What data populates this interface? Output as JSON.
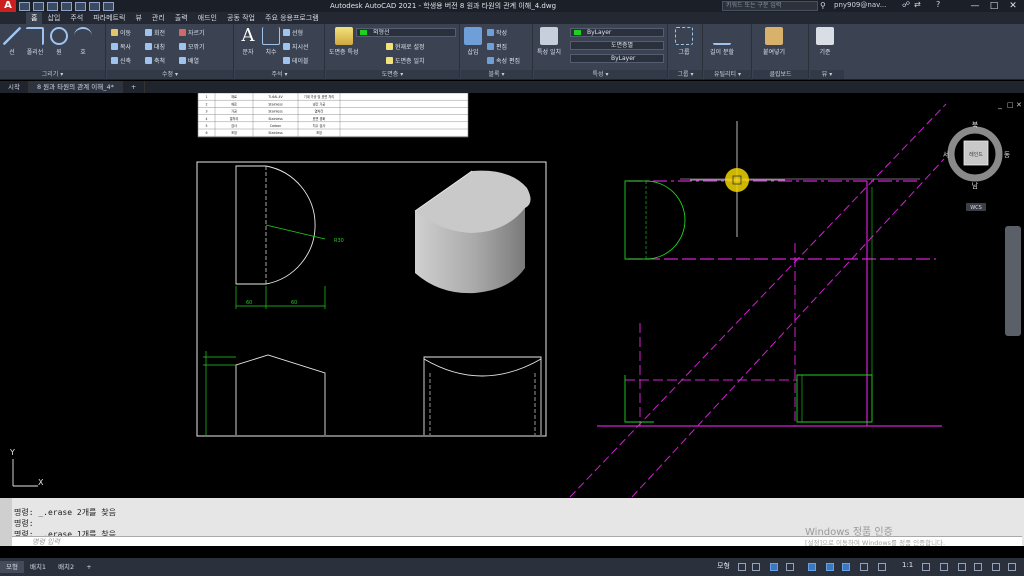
{
  "titlebar": {
    "app_logo": "A",
    "title": "Autodesk AutoCAD 2021 - 학생용 버전    8 원과 타원의 관계 이해_4.dwg",
    "search_placeholder": "키워드 또는 구문 입력",
    "user": "pny909@nav...",
    "minimize": "—",
    "maximize": "□",
    "close": "✕"
  },
  "ribbon_tabs": [
    "홈",
    "삽입",
    "주석",
    "파라메트릭",
    "뷰",
    "관리",
    "출력",
    "애드인",
    "공동 작업",
    "주요 응용프로그램"
  ],
  "ribbon": {
    "draw": {
      "label": "그리기 ▾",
      "line": "선",
      "polyline": "폴리선",
      "circle": "원",
      "arc": "호"
    },
    "modify": {
      "label": "수정 ▾",
      "move": "이동",
      "rotate": "회전",
      "trim": "자르기",
      "copy": "복사",
      "mirror": "대칭",
      "fillet": "모깎기",
      "stretch": "신축",
      "scale": "축척",
      "array": "배열"
    },
    "annotation": {
      "label": "주석 ▾",
      "text": "문자",
      "dimension": "치수",
      "linear": "선형",
      "leader": "지시선",
      "table": "테이블"
    },
    "layers": {
      "label": "도면층 ▾",
      "layer_properties": "도면층 특성",
      "current_layer": "외형선",
      "make_current": "현재로 설정",
      "match": "도면층 일치"
    },
    "block": {
      "label": "블록 ▾",
      "insert": "삽입",
      "create": "작성",
      "edit": "편집",
      "edit_attributes": "속성 편집"
    },
    "properties": {
      "label": "특성 ▾",
      "match_properties": "특성 일치",
      "color": "ByLayer",
      "linetype": "도면층별",
      "lineweight": "ByLayer"
    },
    "groups": {
      "label": "그룹 ▾",
      "group": "그룹"
    },
    "utilities": {
      "label": "유틸리티 ▾",
      "measure": "길이 분할"
    },
    "clipboard": {
      "label": "클립보드",
      "paste": "붙여넣기"
    },
    "view": {
      "label": "뷰 ▾",
      "base": "기준"
    }
  },
  "doc_tabs": [
    "시작",
    "8 원과 타원의 관계 이해_4*"
  ],
  "viewcube": {
    "north": "북",
    "south": "남",
    "east": "동",
    "west": "서",
    "face": "레인드",
    "wcs": "WCS"
  },
  "ucs": {
    "x": "X",
    "y": "Y"
  },
  "table_rows": [
    [
      "1",
      "재료",
      "Ti-6Al-4V",
      "기계 가공 및 표면 처리"
    ],
    [
      "2",
      "재료",
      "Stainless",
      "냉간 가공"
    ],
    [
      "3",
      "가공",
      "Stainless",
      "열처리"
    ],
    [
      "4",
      "열처리",
      "Stainless",
      "표면 경화"
    ],
    [
      "5",
      "검사",
      "Carbon",
      "치수 검사"
    ],
    [
      "6",
      "포장",
      "Stainless",
      "포장"
    ]
  ],
  "drawing": {
    "dim_left": "60",
    "dim_right": "60",
    "dim_radius": "R30"
  },
  "command": {
    "line1": "명령: _.erase 2개를 찾음",
    "line2": "명령:",
    "line3": "명령: _.erase 1개를 찾음",
    "input_placeholder": "명령 입력"
  },
  "watermark": {
    "line1": "Windows 정품 인증",
    "line2": "[설정]으로 이동하여 Windows를 정품 인증합니다."
  },
  "layout_tabs": [
    "모형",
    "배치1",
    "배치2"
  ],
  "status": {
    "model": "모형",
    "scale": "1:1"
  },
  "colors": {
    "magenta": "#d21fd2",
    "green": "#1fd21f",
    "accent": "#3a79c2",
    "cursor": "#f2d600"
  }
}
